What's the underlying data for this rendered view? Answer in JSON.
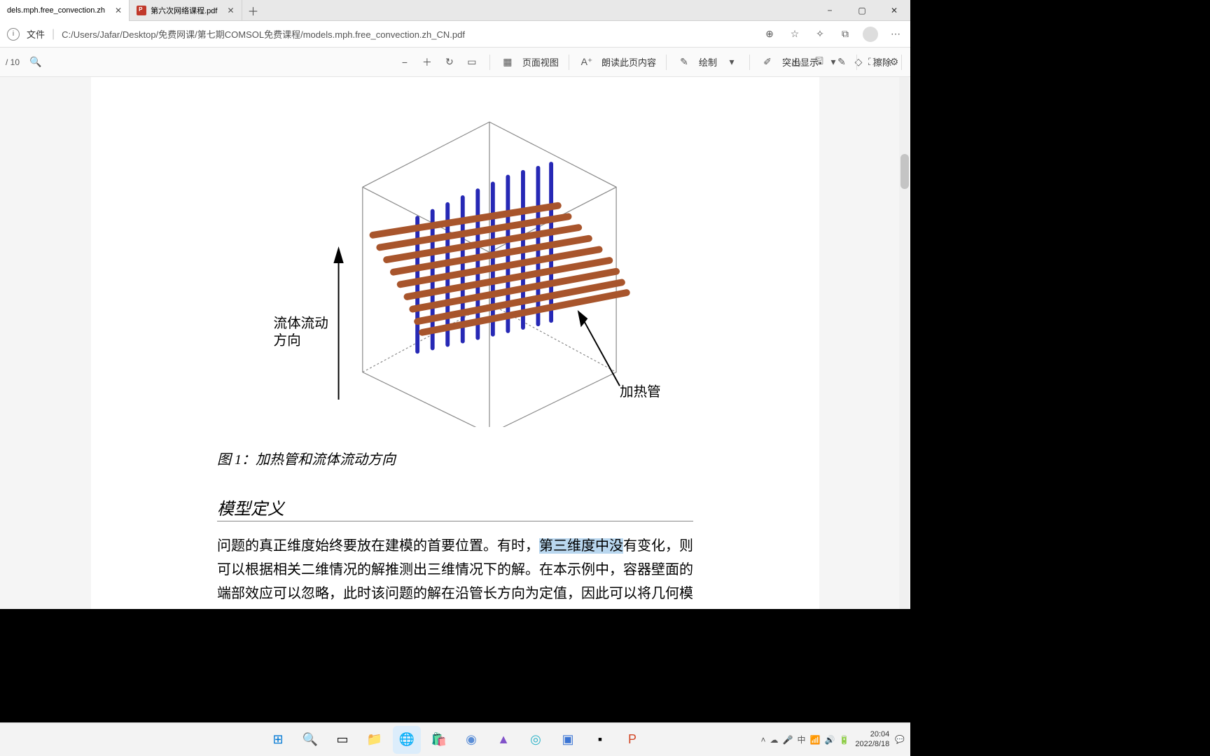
{
  "tabs": {
    "tab1_label": "dels.mph.free_convection.zh",
    "tab2_label": "第六次网络课程.pdf"
  },
  "address": {
    "file_label": "文件",
    "path": "C:/Users/Jafar/Desktop/免费网课/第七期COMSOL免费课程/models.mph.free_convection.zh_CN.pdf"
  },
  "toolbar": {
    "page_info": "/ 10",
    "page_view": "页面视图",
    "read_aloud": "朗读此页内容",
    "draw": "绘制",
    "highlight": "突出显示",
    "erase": "擦除"
  },
  "document": {
    "figure_label_flow1": "流体流动",
    "figure_label_flow2": "方向",
    "figure_label_tubes": "加热管",
    "caption": "图 1：加热管和流体流动方向",
    "heading": "模型定义",
    "body_pre": "问题的真正维度始终要放在建模的首要位置。有时，",
    "body_hl": "第三维度中没",
    "body_post": "有变化，则可以根据相关二维情况的解推测出三维情况下的解。在本示例中，容器壁面的端部效应可以忽略，此时该问题的解在沿管长方向为定值，因此可以将几何模型简化为二维域。"
  },
  "system": {
    "ime": "中",
    "time": "20:04",
    "date": "2022/8/18"
  }
}
